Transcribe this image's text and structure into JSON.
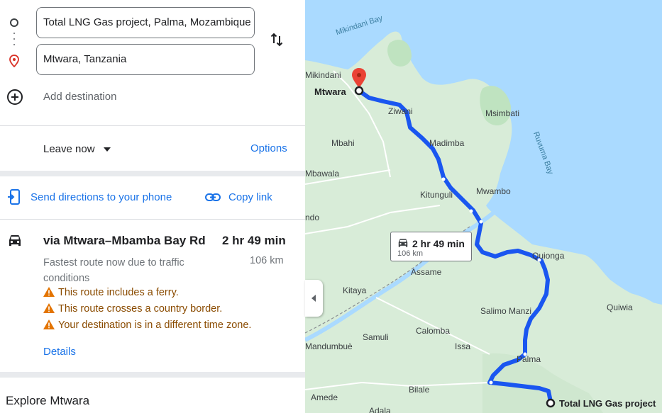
{
  "directions": {
    "origin_value": "Total LNG Gas project, Palma, Mozambique",
    "destination_value": "Mtwara, Tanzania",
    "add_destination": "Add destination",
    "leave_now": "Leave now",
    "options": "Options",
    "send_to_phone": "Send directions to your phone",
    "copy_link": "Copy link"
  },
  "route": {
    "via": "via Mtwara–Mbamba Bay Rd",
    "duration": "2 hr 49 min",
    "description": "Fastest route now due to traffic conditions",
    "distance": "106 km",
    "warnings": [
      "This route includes a ferry.",
      "This route crosses a country border.",
      "Your destination is in a different time zone."
    ],
    "details": "Details"
  },
  "explore": "Explore Mtwara",
  "map": {
    "route_label_duration": "2 hr 49 min",
    "route_label_distance": "106 km",
    "route_color": "#1a56f0",
    "water_color": "#aadaff",
    "land_color": "#d8ecd8",
    "pin_color": "#ea4335",
    "places": {
      "mtwara": "Mtwara",
      "mikindani": "Mikindani",
      "mikindani_bay": "Mikindani Bay",
      "ziwani": "Ziwani",
      "msimbati": "Msimbati",
      "ruvuma_bay": "Ruvuma Bay",
      "mbahi": "Mbahi",
      "madimba": "Madimba",
      "mbawala": "Mbawala",
      "kitunguli": "Kitunguli",
      "mwambo": "Mwambo",
      "ndo": "ndo",
      "quionga": "Quionga",
      "assame": "Assame",
      "kitaya": "Kitaya",
      "salimo_manzi": "Salimo Manzi",
      "quiwia": "Quiwia",
      "samuli": "Samuli",
      "calomba": "Calomba",
      "mandumbue": "Mandumbuè",
      "issa": "Issa",
      "palma": "Palma",
      "bilale": "Bilale",
      "amede": "Amede",
      "adala": "Adala",
      "total_lng": "Total LNG Gas project"
    }
  }
}
